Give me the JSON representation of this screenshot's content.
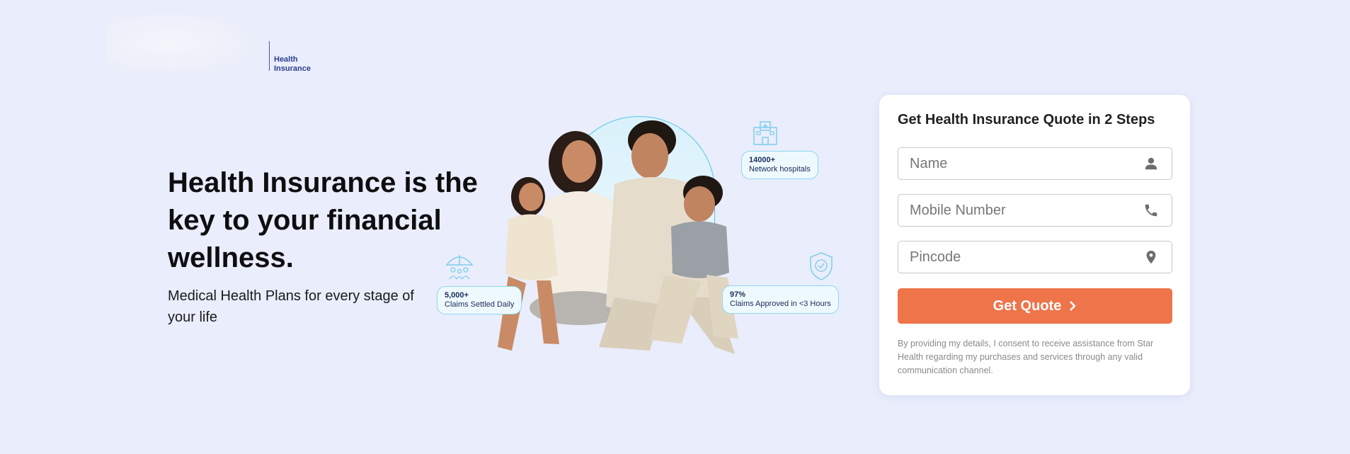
{
  "logo": {
    "text_line1": "Health",
    "text_line2": "Insurance"
  },
  "hero": {
    "title": "Health Insurance is the key to your financial wellness.",
    "subtitle": "Medical Health Plans for every stage of your life"
  },
  "stats": {
    "hospitals": {
      "value": "14000+",
      "label": "Network hospitals",
      "icon": "hospital-icon"
    },
    "claims_settled": {
      "value": "5,000+",
      "label": "Claims Settled Daily",
      "icon": "umbrella-family-icon"
    },
    "claims_approved": {
      "value": "97%",
      "label": "Claims Approved in <3 Hours",
      "icon": "shield-check-icon"
    }
  },
  "form": {
    "title_prefix": "Get Health Insurance Quote in ",
    "title_bold": "2 Steps",
    "name_placeholder": "Name",
    "mobile_placeholder": "Mobile Number",
    "pincode_placeholder": "Pincode",
    "cta_label": "Get Quote",
    "consent": "By providing my details, I consent to receive assistance from Star Health regarding my purchases and services through any valid communication channel."
  },
  "colors": {
    "background": "#e9edfc",
    "accent": "#ee744a",
    "stat_border": "#8fd8ee",
    "brand_blue": "#2c3f8f"
  }
}
